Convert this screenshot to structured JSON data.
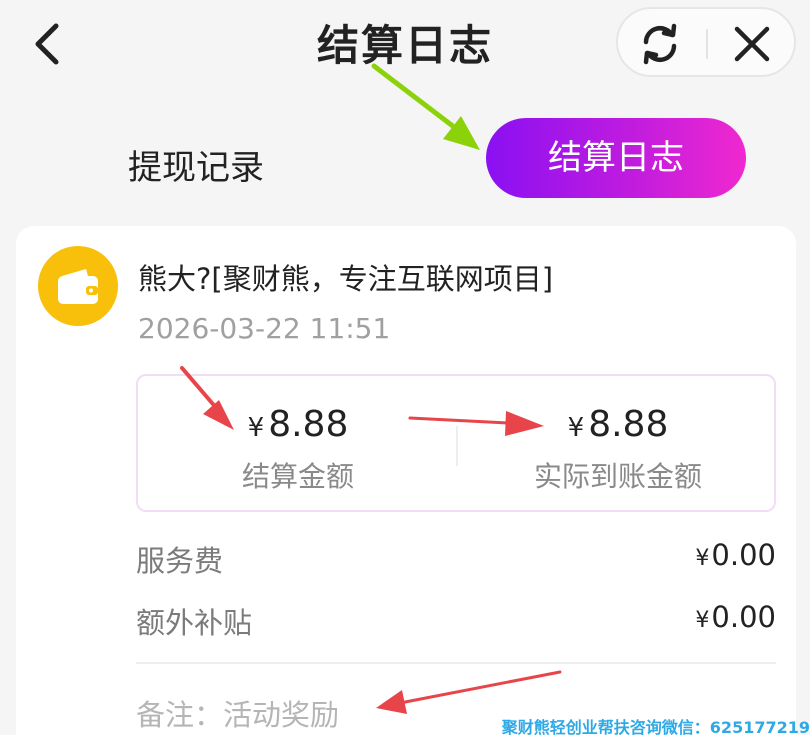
{
  "header": {
    "title": "结算日志",
    "back_icon": "chevron-left-icon",
    "refresh_icon": "refresh-icon",
    "close_icon": "close-icon"
  },
  "tabs": [
    {
      "label": "提现记录",
      "active": false
    },
    {
      "label": "结算日志",
      "active": true
    }
  ],
  "entry": {
    "title": "熊大?[聚财熊，专注互联网项目]",
    "time": "2026-03-22 11:51",
    "icon": "wallet-icon",
    "settle_amount": "8.88",
    "settle_label": "结算金额",
    "received_amount": "8.88",
    "received_label": "实际到账金额",
    "currency": "¥",
    "fees": [
      {
        "label": "服务费",
        "value": "0.00"
      },
      {
        "label": "额外补贴",
        "value": "0.00"
      }
    ],
    "remark": "备注：活动奖励"
  },
  "watermark": "聚财熊轻创业帮扶咨询微信：625177219",
  "colors": {
    "accent_gradient_start": "#8a10f2",
    "accent_gradient_end": "#f028cf",
    "wallet_yellow": "#f8c00a",
    "annotation_red": "#e8454a",
    "annotation_green": "#8cd20a",
    "watermark_blue": "#2fa9e6"
  }
}
